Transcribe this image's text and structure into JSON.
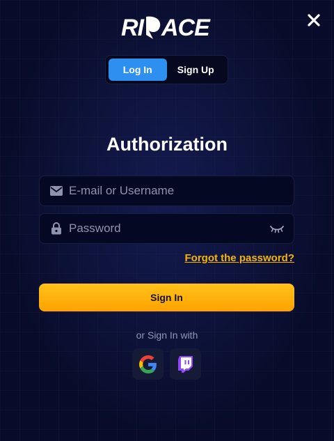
{
  "brand": {
    "logo_text": "RIPACE"
  },
  "tabs": [
    {
      "label": "Log In",
      "active": true
    },
    {
      "label": "Sign Up",
      "active": false
    }
  ],
  "title": "Authorization",
  "form": {
    "username": {
      "placeholder": "E-mail or Username",
      "value": "",
      "icon": "mail-icon"
    },
    "password": {
      "placeholder": "Password",
      "value": "",
      "icon": "lock-icon",
      "toggle_icon": "eye-closed-icon"
    },
    "forgot_label": "Forgot the password?",
    "submit_label": "Sign In"
  },
  "social": {
    "label": "or Sign In with",
    "providers": [
      "google-icon",
      "twitch-icon"
    ]
  },
  "colors": {
    "background": "#080c2a",
    "accent": "#2d8ff0",
    "primary_button": "#ffb300",
    "link": "#f7b500"
  }
}
